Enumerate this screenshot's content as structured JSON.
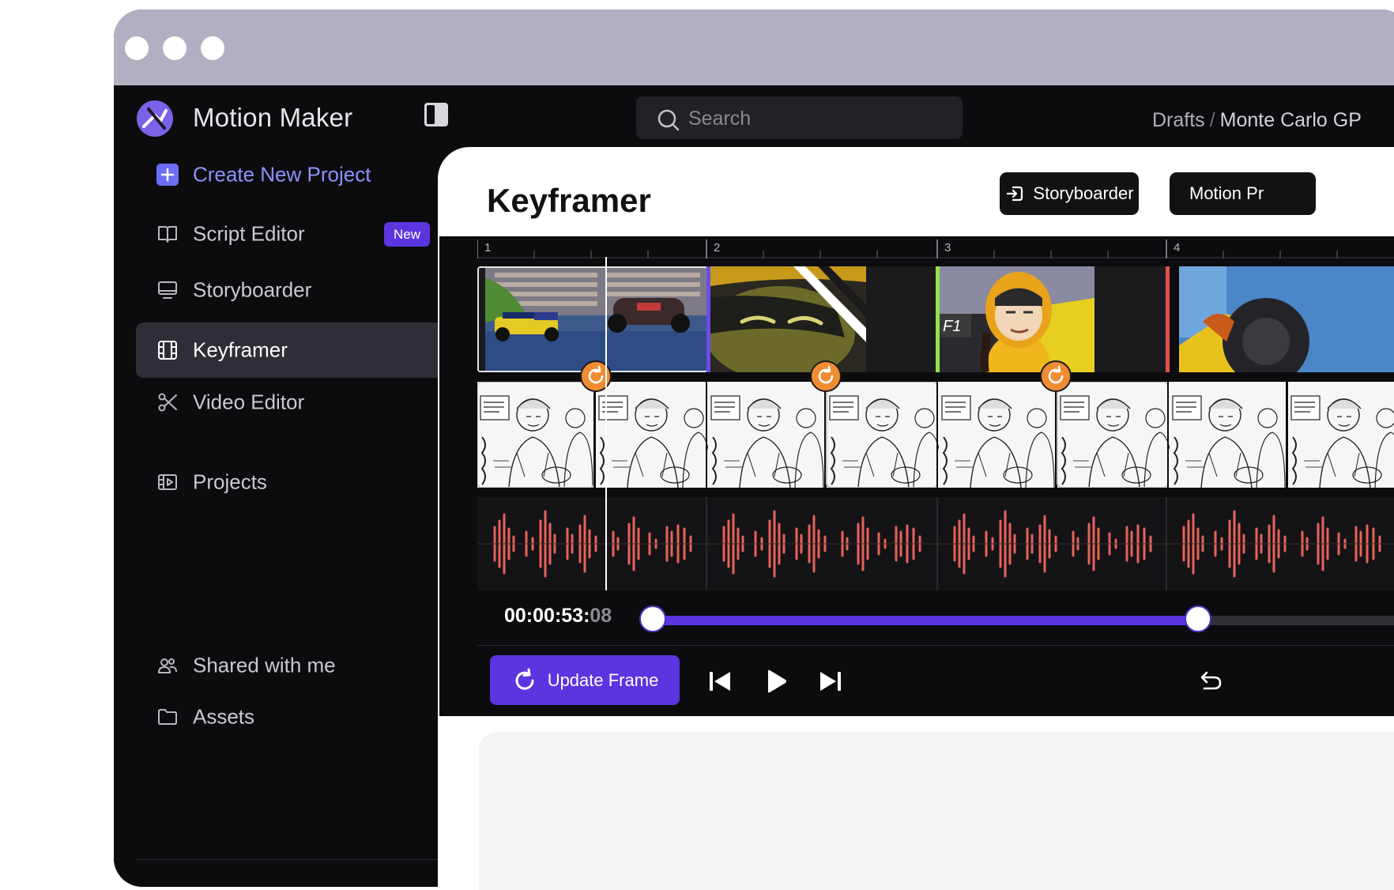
{
  "app": {
    "title": "Motion Maker",
    "accent_color": "#5b35e0",
    "window_controls": [
      "close-dot",
      "minimize-dot",
      "maximize-dot"
    ]
  },
  "sidebar": {
    "collapse_icon": "sidebar-toggle-icon",
    "create_label": "Create New Project",
    "items": [
      {
        "label": "Script Editor",
        "icon": "book-icon",
        "badge": "New"
      },
      {
        "label": "Storyboarder",
        "icon": "monitor-icon"
      },
      {
        "label": "Keyframer",
        "icon": "film-icon",
        "active": true
      },
      {
        "label": "Video Editor",
        "icon": "scissors-icon"
      },
      {
        "label": "Projects",
        "icon": "projects-icon"
      },
      {
        "label": "Shared with me",
        "icon": "users-icon"
      },
      {
        "label": "Assets",
        "icon": "folder-icon"
      }
    ]
  },
  "search": {
    "placeholder": "Search"
  },
  "breadcrumb": {
    "parent": "Drafts",
    "separator": "/",
    "current": "Monte Carlo GP"
  },
  "panel": {
    "title": "Keyframer",
    "storyboarder_button": "Storyboarder",
    "motion_button": "Motion Pr"
  },
  "timeline": {
    "markers": [
      "1",
      "2",
      "3",
      "4"
    ],
    "timecode_main": "00:00:53:",
    "timecode_frames": "08",
    "range_start": 0.0,
    "range_end": 0.72,
    "clip_colors": [
      "#6b4de6",
      "#93e24a",
      "#e0504a"
    ],
    "waveform_color": "#e8625a"
  },
  "controls": {
    "update_label": "Update Frame",
    "prev_icon": "skip-back-icon",
    "play_icon": "play-icon",
    "next_icon": "skip-forward-icon",
    "undo_icon": "undo-icon"
  }
}
